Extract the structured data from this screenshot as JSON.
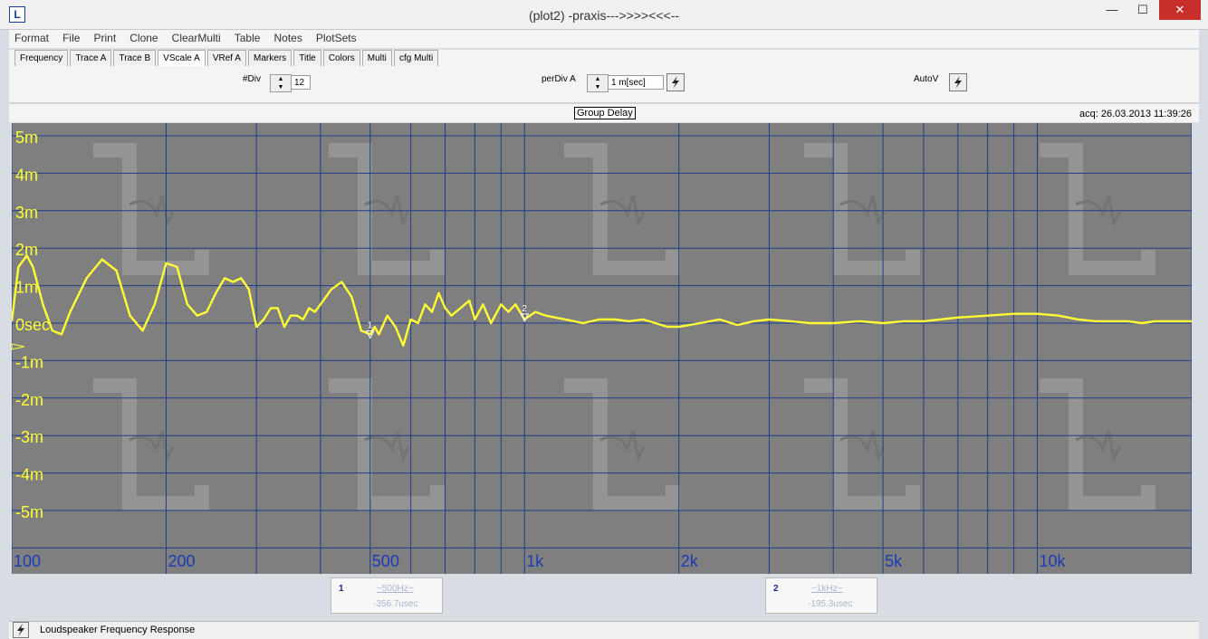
{
  "window": {
    "title": "(plot2) -praxis--->>>><<<--",
    "icon": "app-logo-icon",
    "min": "—",
    "max": "☐",
    "close": "✕",
    "app_letter": "L"
  },
  "menu": [
    "Format",
    "File",
    "Print",
    "Clone",
    "ClearMulti",
    "Table",
    "Notes",
    "PlotSets"
  ],
  "tabs": [
    "Frequency",
    "Trace A",
    "Trace B",
    "VScale A",
    "VRef A",
    "Markers",
    "Title",
    "Colors",
    "Multi",
    "cfg Multi"
  ],
  "active_tab": "VScale A",
  "controls": {
    "ndiv_label": "#Div",
    "ndiv_value": "12",
    "perdiv_label": "perDiv A",
    "perdiv_value": "1 m[sec]",
    "autov_label": "AutoV"
  },
  "plot": {
    "title": "Group Delay",
    "acq": "acq: 26.03.2013 11:39:26"
  },
  "chart_data": {
    "type": "line",
    "title": "Group Delay",
    "x_scale": "log",
    "xlim": [
      100,
      20000
    ],
    "ylim": [
      -5,
      5
    ],
    "y_unit": "sec",
    "ytick_labels": [
      "5m",
      "4m",
      "3m",
      "2m",
      "1m",
      "0sec",
      "-1m",
      "-2m",
      "-3m",
      "-4m",
      "-5m"
    ],
    "xtick_labels": [
      {
        "value": 100,
        "label": "100"
      },
      {
        "value": 200,
        "label": "200"
      },
      {
        "value": 500,
        "label": "500"
      },
      {
        "value": 1000,
        "label": "1k"
      },
      {
        "value": 2000,
        "label": "2k"
      },
      {
        "value": 5000,
        "label": "5k"
      },
      {
        "value": 10000,
        "label": "10k"
      }
    ],
    "grid": true,
    "series": [
      {
        "color": "#ffff33",
        "x": [
          100,
          103,
          107,
          110,
          115,
          120,
          125,
          130,
          140,
          150,
          160,
          170,
          180,
          190,
          200,
          210,
          220,
          230,
          240,
          250,
          260,
          270,
          280,
          290,
          300,
          310,
          320,
          330,
          340,
          350,
          360,
          370,
          380,
          390,
          400,
          420,
          440,
          460,
          480,
          500,
          510,
          520,
          540,
          560,
          580,
          600,
          620,
          640,
          660,
          680,
          700,
          720,
          750,
          780,
          800,
          830,
          860,
          900,
          930,
          960,
          1000,
          1050,
          1100,
          1200,
          1300,
          1400,
          1500,
          1600,
          1700,
          1800,
          1900,
          2000,
          2200,
          2400,
          2600,
          2800,
          3000,
          3300,
          3600,
          4000,
          4500,
          5000,
          5500,
          6000,
          7000,
          8000,
          9000,
          10000,
          11000,
          12000,
          13000,
          14000,
          15000,
          16000,
          17000,
          18000,
          19000,
          20000
        ],
        "y": [
          0.05,
          1.5,
          1.8,
          1.5,
          0.5,
          -0.2,
          -0.3,
          0.3,
          1.2,
          1.7,
          1.4,
          0.2,
          -0.2,
          0.5,
          1.6,
          1.5,
          0.5,
          0.2,
          0.3,
          0.8,
          1.2,
          1.1,
          1.2,
          0.9,
          -0.1,
          0.1,
          0.4,
          0.4,
          -0.1,
          0.2,
          0.2,
          0.1,
          0.4,
          0.3,
          0.5,
          0.9,
          1.1,
          0.7,
          -0.2,
          -0.3,
          -0.1,
          -0.3,
          0.2,
          -0.1,
          -0.6,
          0.1,
          0.0,
          0.5,
          0.3,
          0.8,
          0.4,
          0.2,
          0.4,
          0.6,
          0.1,
          0.5,
          0.0,
          0.5,
          0.3,
          0.5,
          0.1,
          0.3,
          0.2,
          0.1,
          0.0,
          0.1,
          0.1,
          0.05,
          0.1,
          0.0,
          -0.1,
          -0.1,
          0.0,
          0.1,
          -0.05,
          0.05,
          0.1,
          0.05,
          0.0,
          0.0,
          0.05,
          0.0,
          0.05,
          0.05,
          0.15,
          0.2,
          0.25,
          0.25,
          0.2,
          0.1,
          0.05,
          0.05,
          0.05,
          0.0,
          0.05,
          0.05,
          0.05,
          0.05
        ]
      }
    ]
  },
  "markers": [
    {
      "num": "1",
      "freq": "~500Hz~",
      "value": "-356.7usec",
      "label": "1",
      "x": 500,
      "y": -0.35
    },
    {
      "num": "2",
      "freq": "~1kHz~",
      "value": "-195.3usec",
      "label": "2",
      "x": 1000,
      "y": 0.1
    }
  ],
  "status": {
    "text": "Loudspeaker Frequency Response"
  }
}
